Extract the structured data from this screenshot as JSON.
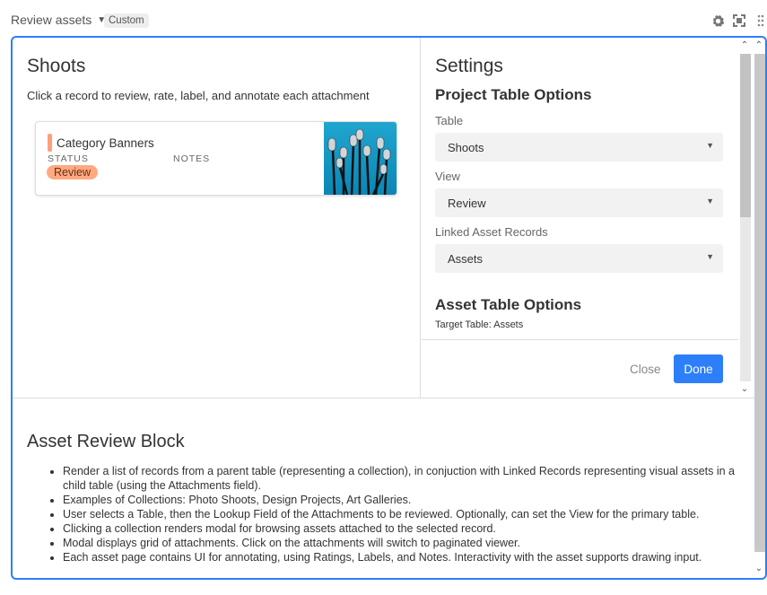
{
  "header": {
    "title": "Review assets",
    "badge": "Custom"
  },
  "shoots": {
    "title": "Shoots",
    "subtitle": "Click a record to review, rate, label, and annotate each attachment",
    "record": {
      "name": "Category Banners",
      "status_label": "STATUS",
      "notes_label": "NOTES",
      "status": "Review",
      "status_color": "#ffa981"
    }
  },
  "settings": {
    "title": "Settings",
    "project_section": "Project Table Options",
    "table_label": "Table",
    "table_value": "Shoots",
    "view_label": "View",
    "view_value": "Review",
    "linked_label": "Linked Asset Records",
    "linked_value": "Assets",
    "asset_section": "Asset Table Options",
    "target_table": "Target Table: Assets",
    "close_label": "Close",
    "done_label": "Done",
    "accent_color": "#2d7ff9"
  },
  "description": {
    "title": "Asset Review Block",
    "bullets": [
      "Render a list of records from a parent table (representing a collection), in conjuction with Linked Records representing visual assets in a child table (using the Attachments field).",
      "Examples of Collections: Photo Shoots, Design Projects, Art Galleries.",
      "User selects a Table, then the Lookup Field of the Attachments to be reviewed. Optionally, can set the View for the primary table.",
      "Clicking a collection renders modal for browsing assets attached to the selected record.",
      "Modal displays grid of attachments. Click on the attachments will switch to paginated viewer.",
      "Each asset page contains UI for annotating, using Ratings, Labels, and Notes. Interactivity with the asset supports drawing input."
    ]
  },
  "icons": {
    "settings": "gear-icon",
    "expand": "fullscreen-icon",
    "drag": "drag-handle-icon"
  }
}
